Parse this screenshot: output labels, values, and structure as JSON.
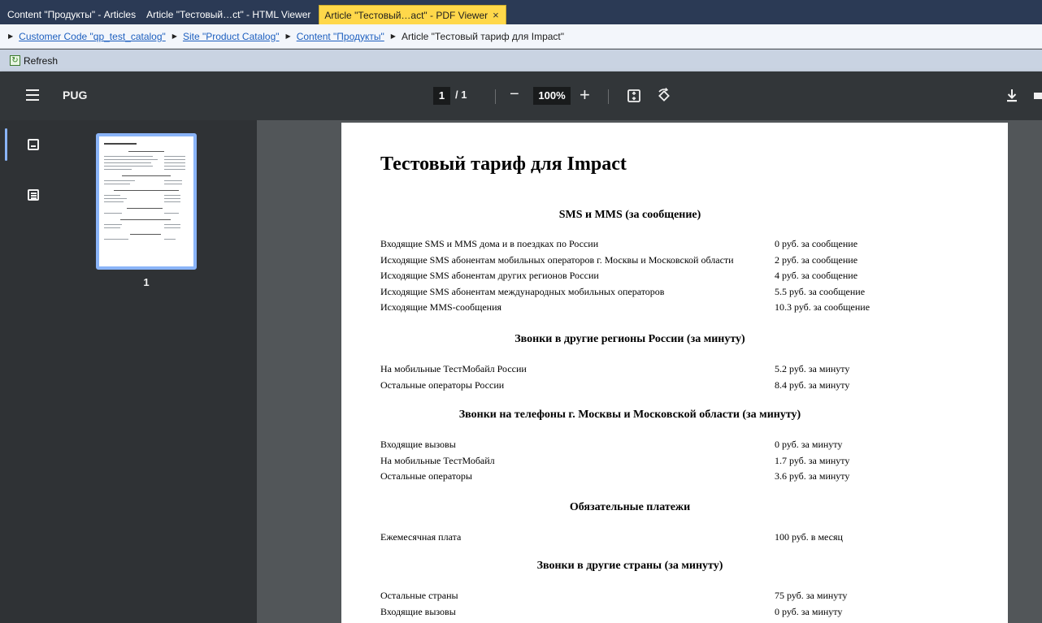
{
  "tabs": [
    {
      "label": "Content \"Продукты\" - Articles",
      "active": false
    },
    {
      "label": "Article \"Тестовый…ct\" - HTML Viewer",
      "active": false
    },
    {
      "label": "Article \"Тестовый…act\" - PDF Viewer",
      "active": true,
      "close": "×"
    }
  ],
  "breadcrumb": {
    "items": [
      {
        "label": "Customer Code \"qp_test_catalog\"",
        "link": true
      },
      {
        "label": "Site \"Product Catalog\"",
        "link": true
      },
      {
        "label": "Content \"Продукты\"",
        "link": true
      },
      {
        "label": "Article \"Тестовый тариф для Impact\"",
        "link": false
      }
    ]
  },
  "toolbar": {
    "refresh_label": "Refresh"
  },
  "pdf_toolbar": {
    "title": "PUG",
    "current_page": "1",
    "page_total": "/ 1",
    "zoom": "100%",
    "zoom_out": "−",
    "zoom_in": "+"
  },
  "sidebar": {
    "thumbnail_page": "1"
  },
  "document": {
    "title": "Тестовый тариф для Impact",
    "sections": [
      {
        "heading": "SMS и MMS (за сообщение)",
        "rows": [
          {
            "name": "Входящие SMS и MMS дома и в поездках по России",
            "price": "0 руб. за сообщение"
          },
          {
            "name": "Исходящие SMS абонентам мобильных операторов г. Москвы и Московской области",
            "price": "2 руб. за сообщение"
          },
          {
            "name": "Исходящие SMS абонентам других регионов России",
            "price": "4 руб. за сообщение"
          },
          {
            "name": "Исходящие SMS абонентам международных мобильных операторов",
            "price": "5.5 руб. за сообщение"
          },
          {
            "name": "Исходящие MMS-сообщения",
            "price": "10.3 руб. за сообщение"
          }
        ]
      },
      {
        "heading": "Звонки в другие регионы России (за минуту)",
        "rows": [
          {
            "name": "На мобильные ТестМобайл России",
            "price": "5.2 руб. за минуту"
          },
          {
            "name": "Остальные операторы России",
            "price": "8.4 руб. за минуту"
          }
        ]
      },
      {
        "heading": "Звонки на телефоны г. Москвы и Московской области (за минуту)",
        "rows": [
          {
            "name": "Входящие вызовы",
            "price": "0 руб. за минуту"
          },
          {
            "name": "На мобильные ТестМобайл",
            "price": "1.7 руб. за минуту"
          },
          {
            "name": "Остальные операторы",
            "price": "3.6 руб. за минуту"
          }
        ]
      },
      {
        "heading": "Обязательные платежи",
        "rows": [
          {
            "name": "Ежемесячная плата",
            "price": "100 руб. в месяц"
          }
        ]
      },
      {
        "heading": "Звонки в другие страны (за минуту)",
        "rows": [
          {
            "name": "Остальные страны",
            "price": "75 руб. за минуту"
          },
          {
            "name": "Входящие вызовы",
            "price": "0 руб. за минуту"
          }
        ]
      }
    ]
  }
}
